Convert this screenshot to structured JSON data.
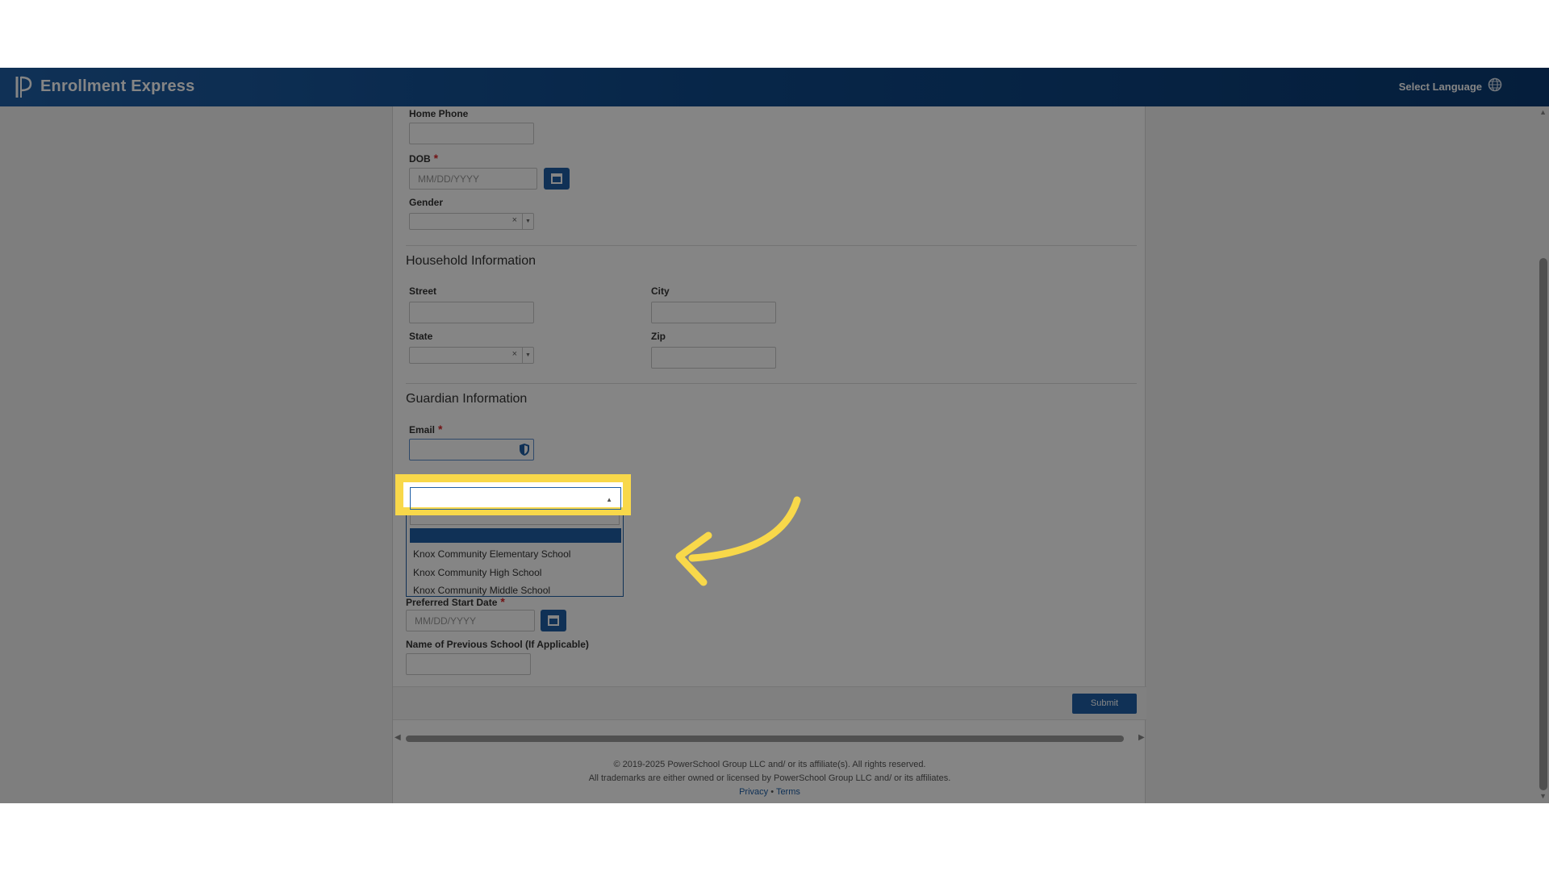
{
  "header": {
    "app_title": "Enrollment Express",
    "select_language": "Select Language",
    "logo_icon": "powerschool-logo-icon",
    "language_icon": "globe-icon"
  },
  "student_fields": {
    "home_phone_label": "Home Phone",
    "dob_label": "DOB",
    "dob_placeholder": "MM/DD/YYYY",
    "gender_label": "Gender",
    "clear_symbol": "×"
  },
  "household": {
    "title": "Household Information",
    "street_label": "Street",
    "city_label": "City",
    "state_label": "State",
    "zip_label": "Zip"
  },
  "guardian": {
    "title": "Guardian Information",
    "email_label": "Email",
    "required_mark": "*"
  },
  "school_dropdown": {
    "selected_value": "",
    "options": [
      "Knox Community Elementary School",
      "Knox Community High School",
      "Knox Community Middle School"
    ]
  },
  "enrollment": {
    "start_date_label": "Preferred Start Date",
    "start_date_placeholder": "MM/DD/YYYY",
    "previous_school_label": "Name of Previous School (If Applicable)"
  },
  "actions": {
    "submit_label": "Submit"
  },
  "footer": {
    "copyright_line1": "© 2019-2025 PowerSchool Group LLC and/ or its affiliate(s). All rights reserved.",
    "copyright_line2": "All trademarks are either owned or licensed by PowerSchool Group LLC and/ or its affiliates.",
    "privacy_link": "Privacy",
    "separator": "•",
    "terms_link": "Terms"
  },
  "colors": {
    "brand_blue": "#1f5fa6",
    "highlight_yellow": "#f8d84a",
    "required_red": "#d9262a"
  }
}
